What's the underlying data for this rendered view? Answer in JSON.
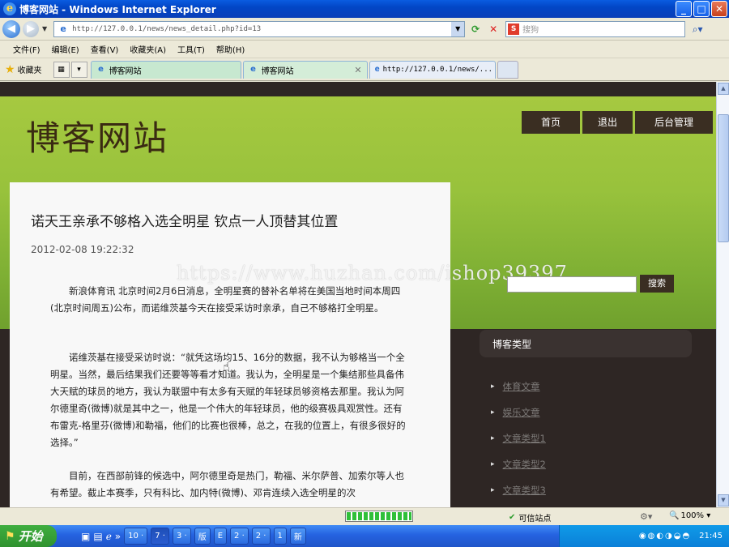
{
  "window": {
    "title": "博客网站 - Windows Internet Explorer",
    "controls": {
      "minimize": "_",
      "maximize": "□",
      "close": "✕"
    }
  },
  "address_bar": {
    "url": "http://127.0.0.1/news/news_detail.php?id=13",
    "search_placeholder": "搜狗"
  },
  "menu": [
    "文件(F)",
    "编辑(E)",
    "查看(V)",
    "收藏夹(A)",
    "工具(T)",
    "帮助(H)"
  ],
  "favorites_label": "收藏夹",
  "tabs": [
    {
      "label": "博客网站"
    },
    {
      "label": "博客网站",
      "close": "✕"
    },
    {
      "label": "http://127.0.0.1/news/..."
    }
  ],
  "site": {
    "title": "博客网站",
    "nav": [
      "首页",
      "退出",
      "后台管理"
    ],
    "search_button": "搜索"
  },
  "article": {
    "title": "诺天王亲承不够格入选全明星 钦点一人顶替其位置",
    "date": "2012-02-08 19:22:32",
    "paragraphs": [
      "新浪体育讯  北京时间2月6日消息，全明星赛的替补名单将在美国当地时间本周四(北京时间周五)公布，而诺维茨基今天在接受采访时亲承，自己不够格打全明星。",
      "诺维茨基在接受采访时说：“就凭这场均15、16分的数据，我不认为够格当一个全明星。当然，最后结果我们还要等等看才知道。我认为，全明星是一个集结那些具备伟大天赋的球员的地方，我认为联盟中有太多有天赋的年轻球员够资格去那里。我认为阿尔德里奇(微博)就是其中之一，他是一个伟大的年轻球员，他的级赛极具观赏性。还有布雷克-格里芬(微博)和勒福，他们的比赛也很棒，总之，在我的位置上，有很多很好的选择。”",
      "目前，在西部前锋的候选中，阿尔德里奇是热门，勒福、米尔萨普、加索尔等人也有希望。截止本赛季，只有科比、加内特(微博)、邓肯连续入选全明星的次"
    ]
  },
  "watermark": "https://www.huzhan.com/ishop39397",
  "sidebar": {
    "category_header": "博客类型",
    "categories": [
      "体育文章",
      "娱乐文章",
      "文章类型1",
      "文章类型2",
      "文章类型3"
    ]
  },
  "status": {
    "progress": 1.0,
    "zone": "可信站点",
    "zoom": "100%"
  },
  "taskbar": {
    "start": "开始",
    "tasks": [
      "10 ·",
      "7 ·",
      "3 ·",
      "版",
      "E",
      "2 ·",
      "2 ·",
      "1",
      "新"
    ],
    "clock": "21:45"
  }
}
